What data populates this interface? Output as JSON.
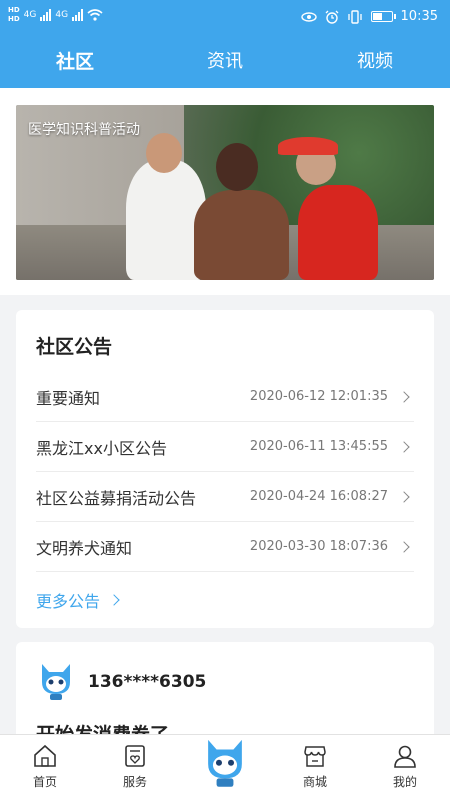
{
  "status_bar": {
    "hd_top": "HD",
    "hd_bottom": "HD",
    "net1": "4G",
    "net2": "4G",
    "time": "10:35"
  },
  "top_tabs": [
    {
      "label": "社区",
      "active": true
    },
    {
      "label": "资讯",
      "active": false
    },
    {
      "label": "视频",
      "active": false
    }
  ],
  "banner": {
    "caption": "医学知识科普活动"
  },
  "notice": {
    "title": "社区公告",
    "items": [
      {
        "title": "重要通知",
        "date": "2020-06-12 12:01:35"
      },
      {
        "title": "黑龙江xx小区公告",
        "date": "2020-06-11 13:45:55"
      },
      {
        "title": "社区公益募捐活动公告",
        "date": "2020-04-24 16:08:27"
      },
      {
        "title": "文明养犬通知",
        "date": "2020-03-30 18:07:36"
      }
    ],
    "more_label": "更多公告"
  },
  "user_post": {
    "phone": "136****6305",
    "text": "开始发消费券了"
  },
  "bottom_nav": [
    {
      "label": "首页",
      "icon": "home-icon"
    },
    {
      "label": "服务",
      "icon": "service-icon"
    },
    {
      "label": "",
      "icon": "mascot-icon"
    },
    {
      "label": "商城",
      "icon": "shop-icon"
    },
    {
      "label": "我的",
      "icon": "user-icon"
    }
  ],
  "colors": {
    "primary": "#3fa6ec",
    "background": "#f2f3f5"
  }
}
